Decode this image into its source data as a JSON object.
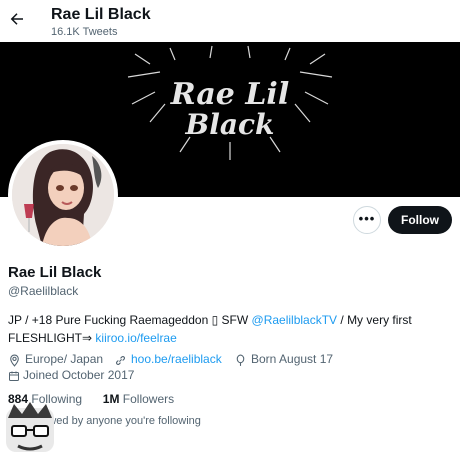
{
  "header": {
    "title": "Rae Lil Black",
    "tweet_count": "16.1K Tweets"
  },
  "banner": {
    "logo_line1": "Rae Lil",
    "logo_line2": "Black"
  },
  "actions": {
    "more_label": "•••",
    "follow_label": "Follow"
  },
  "profile": {
    "name": "Rae Lil Black",
    "handle": "@Raelilblack",
    "bio_part1": "JP / +18 Pure Fucking Raemageddon ▯ SFW ",
    "bio_link1": "@RaelilblackTV",
    "bio_part2": " / My very first FLESHLIGHT⇒ ",
    "bio_link2": "kiiroo.io/feelrae",
    "location": "Europe/ Japan",
    "website": "hoo.be/raeliblack",
    "birthday": "Born August 17",
    "joined": "Joined October 2017"
  },
  "stats": {
    "following_count": "884",
    "following_label": "Following",
    "followers_count": "1M",
    "followers_label": "Followers"
  },
  "followed_by": "Not followed by anyone you're following",
  "icons": {
    "back": "arrow-left-icon",
    "location": "location-pin-icon",
    "link": "link-icon",
    "birthday": "balloon-icon",
    "joined": "calendar-icon"
  },
  "colors": {
    "accent": "#1d9bf0",
    "text": "#0f1419",
    "secondary": "#536471",
    "banner": "#000000",
    "follow_bg": "#0f1419"
  }
}
